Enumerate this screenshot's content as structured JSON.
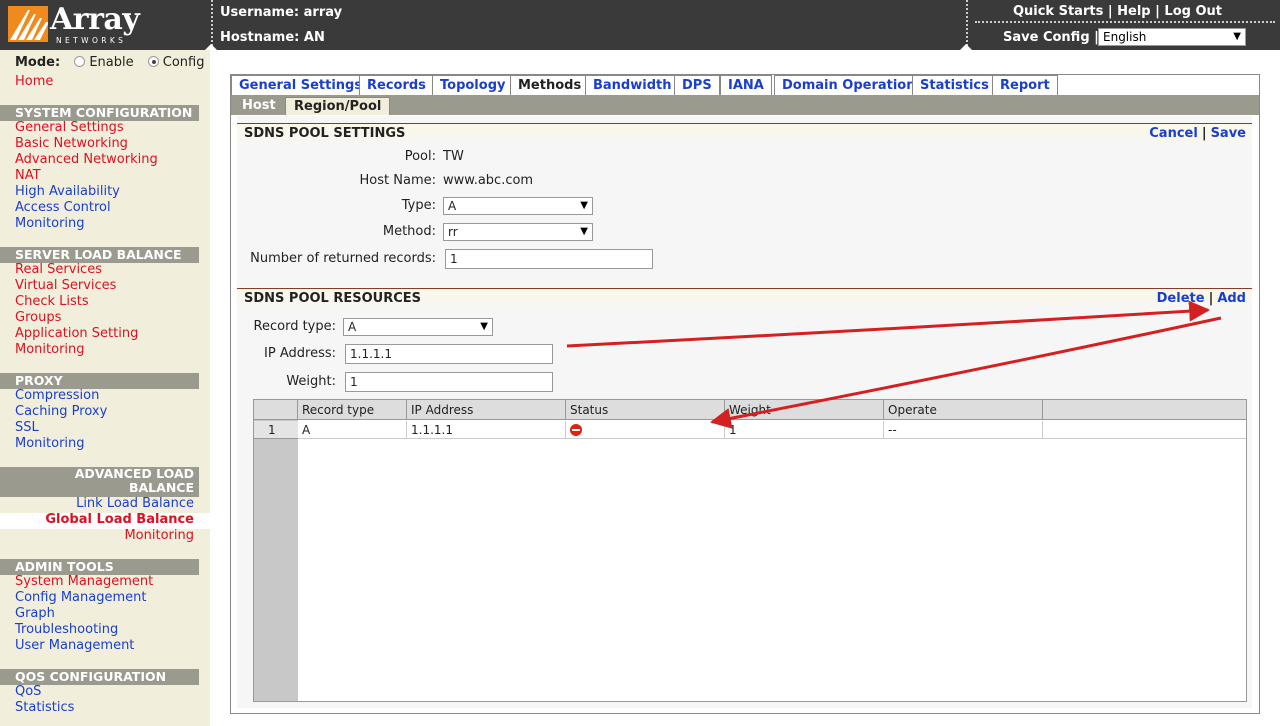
{
  "header": {
    "logo_word": "Array",
    "logo_sub": "NETWORKS",
    "username_label": "Username: array",
    "hostname_label": "Hostname: AN",
    "links": [
      "Quick Starts",
      "Help",
      "Log Out"
    ],
    "save_config": "Save Config",
    "language": "English"
  },
  "sidebar": {
    "mode_label": "Mode:",
    "mode_enable": "Enable",
    "mode_config": "Config",
    "home": "Home",
    "system_configuration": {
      "title": "SYSTEM CONFIGURATION",
      "items": [
        "General Settings",
        "Basic Networking",
        "Advanced Networking",
        "NAT",
        "High Availability",
        "Access Control",
        "Monitoring"
      ]
    },
    "server_load_balance": {
      "title": "SERVER LOAD BALANCE",
      "items": [
        "Real Services",
        "Virtual Services",
        "Check Lists",
        "Groups",
        "Application Setting",
        "Monitoring"
      ]
    },
    "proxy": {
      "title": "PROXY",
      "items": [
        "Compression",
        "Caching Proxy",
        "SSL",
        "Monitoring"
      ]
    },
    "advanced_load_balance": {
      "title_line1": "ADVANCED LOAD",
      "title_line2": "BALANCE",
      "items": [
        "Link Load Balance",
        "Global Load Balance",
        "Monitoring"
      ]
    },
    "admin_tools": {
      "title": "ADMIN TOOLS",
      "items": [
        "System Management",
        "Config Management",
        "Graph",
        "Troubleshooting",
        "User Management"
      ]
    },
    "qos_configuration": {
      "title": "QOS CONFIGURATION",
      "items": [
        "QoS",
        "Statistics"
      ]
    }
  },
  "tabs": [
    "General Settings",
    "Records",
    "Topology",
    "Methods",
    "Bandwidth",
    "DPS",
    "IANA",
    "Domain Operation",
    "Statistics",
    "Report"
  ],
  "subtabs": [
    "Host",
    "Region/Pool"
  ],
  "pool_settings": {
    "title": "SDNS POOL SETTINGS",
    "cancel": "Cancel",
    "save": "Save",
    "pool_label": "Pool:",
    "pool_value": "TW",
    "host_label": "Host Name:",
    "host_value": "www.abc.com",
    "type_label": "Type:",
    "type_value": "A",
    "method_label": "Method:",
    "method_value": "rr",
    "returned_label": "Number of returned records:",
    "returned_value": "1"
  },
  "pool_resources": {
    "title": "SDNS POOL RESOURCES",
    "delete": "Delete",
    "add": "Add",
    "record_type_label": "Record type:",
    "record_type_value": "A",
    "ip_label": "IP Address:",
    "ip_value": "1.1.1.1",
    "weight_label": "Weight:",
    "weight_value": "1"
  },
  "grid": {
    "columns": [
      "Record type",
      "IP Address",
      "Status",
      "Weight",
      "Operate"
    ],
    "rows": [
      {
        "num": "1",
        "record_type": "A",
        "ip": "1.1.1.1",
        "status_icon": "minus-circle-icon",
        "weight": "1",
        "operate": "--"
      }
    ]
  },
  "colors": {
    "header_bg": "#3a3a3a",
    "sidebar_bg": "#f1efdb",
    "link_red": "#d12",
    "link_blue": "#1a3fcc",
    "arrow_red": "#d42020"
  }
}
